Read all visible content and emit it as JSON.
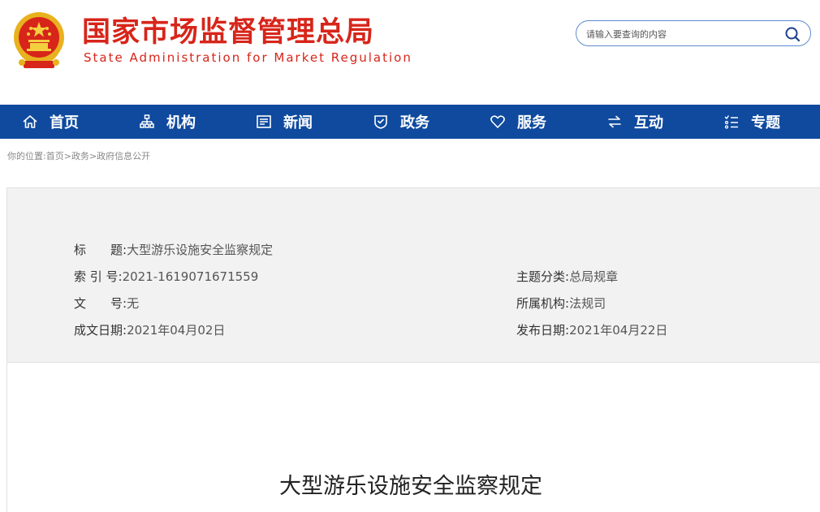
{
  "header": {
    "title_cn": "国家市场监督管理总局",
    "title_en": "State Administration for Market Regulation",
    "emblem_icon": "national-emblem-icon",
    "search": {
      "placeholder": "请输入要查询的内容",
      "icon": "search-icon"
    }
  },
  "nav": {
    "items": [
      {
        "label": "首页",
        "icon": "home-icon"
      },
      {
        "label": "机构",
        "icon": "org-chart-icon"
      },
      {
        "label": "新闻",
        "icon": "news-icon"
      },
      {
        "label": "政务",
        "icon": "shield-icon"
      },
      {
        "label": "服务",
        "icon": "heart-icon"
      },
      {
        "label": "互动",
        "icon": "exchange-icon"
      },
      {
        "label": "专题",
        "icon": "list-icon"
      }
    ]
  },
  "breadcrumb": {
    "prefix": "你的位置:",
    "items": [
      "首页",
      "政务",
      "政府信息公开"
    ],
    "separator": ">"
  },
  "info": {
    "title_label": "标　　题:",
    "title_value": "大型游乐设施安全监察规定",
    "index_label": "索 引 号:",
    "index_value": "2021-1619071671559",
    "topic_label": "主题分类:",
    "topic_value": "总局规章",
    "docno_label": "文　　号:",
    "docno_value": "无",
    "org_label": "所属机构:",
    "org_value": "法规司",
    "written_label": "成文日期:",
    "written_value": "2021年04月02日",
    "published_label": "发布日期:",
    "published_value": "2021年04月22日"
  },
  "document": {
    "title": "大型游乐设施安全监察规定"
  },
  "colors": {
    "brand_red": "#d7251a",
    "nav_blue": "#0f4a9e",
    "panel_gray": "#f2f2f2"
  }
}
